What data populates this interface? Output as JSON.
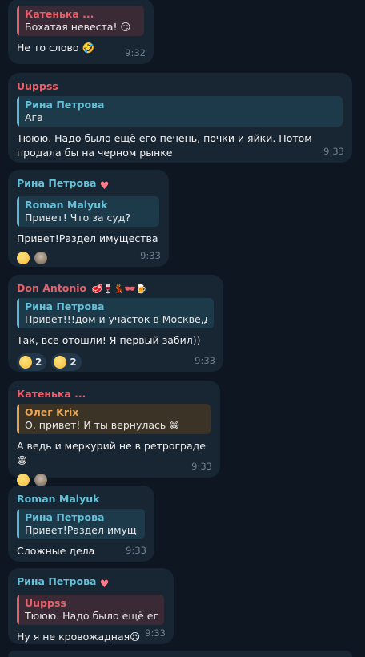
{
  "messages": [
    {
      "sender": "",
      "reply": {
        "name": "Катенька ...",
        "text": "Бохатая невеста! 😏"
      },
      "text": "Не то слово 🤣",
      "time": "9:32"
    },
    {
      "sender": "Uuppss",
      "reply": {
        "name": "Рина Петрова",
        "text": "Ага"
      },
      "text": "Тююю. Надо было ещё его печень, почки и яйки. Потом продала бы на черном рынке",
      "time": "9:33"
    },
    {
      "sender": "Рина Петрова",
      "sender_badge": "heart-icon",
      "reply": {
        "name": "Roman Malyuk",
        "text": "Привет! Что за суд?"
      },
      "text": "Привет!Раздел имущества",
      "reactions": [
        {
          "icon": "grimace-face-icon",
          "count": ""
        },
        {
          "icon": "avatar-photo-icon",
          "count": ""
        }
      ],
      "time": "9:33"
    },
    {
      "sender": "Don Antonio",
      "sender_badge": "steak-wine-dancer-glasses-beer-icons",
      "reply": {
        "name": "Рина Петрова",
        "text": "Привет!!!дом и участок в Москве,др..."
      },
      "text": "Так, все отошли! Я первый забил))",
      "reactions": [
        {
          "icon": "grimace-face-icon",
          "count": "2"
        },
        {
          "icon": "rofl-face-icon",
          "count": "2"
        }
      ],
      "time": "9:33"
    },
    {
      "sender": "Катенька ...",
      "reply": {
        "name": "Олег Krix",
        "text": "О, привет! И ты вернулась 😁"
      },
      "text": "А ведь и меркурий не в ретрограде 😁",
      "reactions": [
        {
          "icon": "thinking-face-icon",
          "count": ""
        },
        {
          "icon": "avatar-photo-icon",
          "count": ""
        }
      ],
      "time": "9:33"
    },
    {
      "sender": "Roman Malyuk",
      "reply": {
        "name": "Рина Петрова",
        "text": "Привет!Раздел имущ..."
      },
      "text": "Сложные дела",
      "time": "9:33"
    },
    {
      "sender": "Рина Петрова",
      "sender_badge": "heart-icon",
      "reply": {
        "name": "Uuppss",
        "text": "Тююю. Надо было ещё ег..."
      },
      "text": "Ну я не кровожадная😍",
      "time": "9:33"
    }
  ],
  "colors": {
    "background": "#0e1621",
    "bubble": "#182533",
    "accent_blue": "#5fb8d9",
    "accent_red": "#e8606a",
    "accent_orange": "#e8a554"
  }
}
